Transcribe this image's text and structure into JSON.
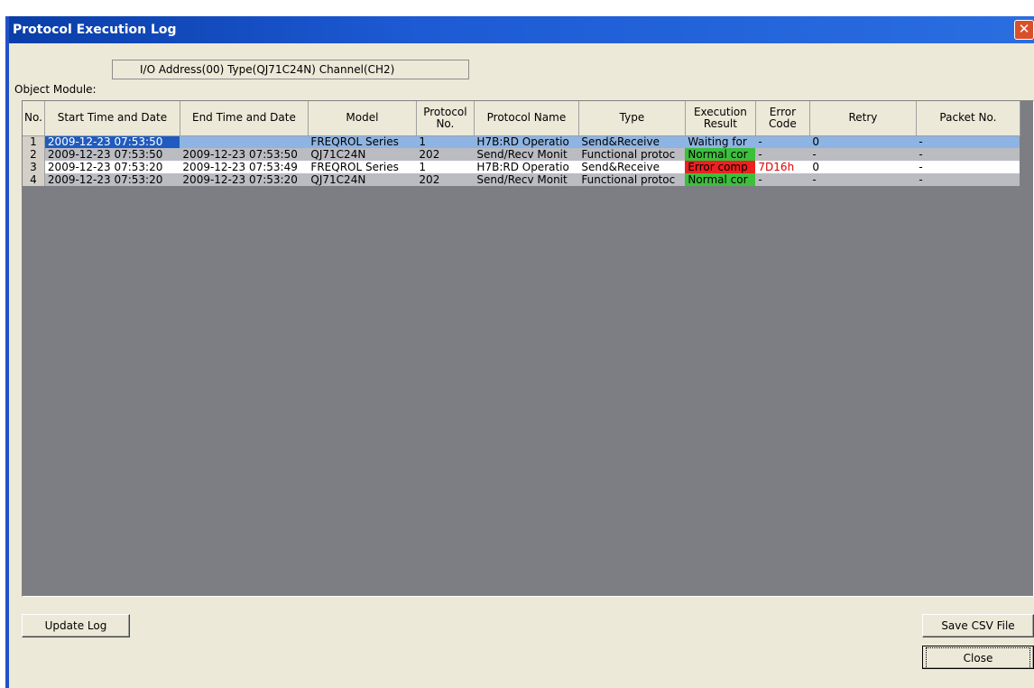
{
  "window": {
    "title": "Protocol Execution Log",
    "close_glyph": "✕"
  },
  "object_module": {
    "label": "Object Module:",
    "value": "I/O Address(00) Type(QJ71C24N) Channel(CH2)"
  },
  "table": {
    "headers": [
      "No.",
      "Start Time and Date",
      "End Time and Date",
      "Model",
      "Protocol No.",
      "Protocol Name",
      "Type",
      "Execution Result",
      "Error Code",
      "Retry",
      "Packet No."
    ],
    "rows": [
      {
        "no": "1",
        "start": "2009-12-23 07:53:50",
        "end": "",
        "model": "FREQROL Series",
        "protocol_no": "1",
        "protocol_name": "H7B:RD Operatio",
        "type": "Send&Receive",
        "result": "Waiting for",
        "error_code": "-",
        "retry": "0",
        "packet_no": "-"
      },
      {
        "no": "2",
        "start": "2009-12-23 07:53:50",
        "end": "2009-12-23 07:53:50",
        "model": "QJ71C24N",
        "protocol_no": "202",
        "protocol_name": "Send/Recv Monit",
        "type": "Functional protoc",
        "result": "Normal cor",
        "error_code": "-",
        "retry": "-",
        "packet_no": "-"
      },
      {
        "no": "3",
        "start": "2009-12-23 07:53:20",
        "end": "2009-12-23 07:53:49",
        "model": "FREQROL Series",
        "protocol_no": "1",
        "protocol_name": "H7B:RD Operatio",
        "type": "Send&Receive",
        "result": "Error comp",
        "error_code": "7D16h",
        "retry": "0",
        "packet_no": "-"
      },
      {
        "no": "4",
        "start": "2009-12-23 07:53:20",
        "end": "2009-12-23 07:53:20",
        "model": "QJ71C24N",
        "protocol_no": "202",
        "protocol_name": "Send/Recv Monit",
        "type": "Functional protoc",
        "result": "Normal cor",
        "error_code": "-",
        "retry": "-",
        "packet_no": "-"
      }
    ]
  },
  "buttons": {
    "update_log": "Update Log",
    "save_csv": "Save CSV File",
    "close": "Close"
  },
  "colors": {
    "title_bar": "#1d5ad4",
    "selected_row": "#8db4e3",
    "normal_result": "#3cbf3c",
    "error_result": "#ee2020",
    "grid_background": "#7d7e83"
  }
}
